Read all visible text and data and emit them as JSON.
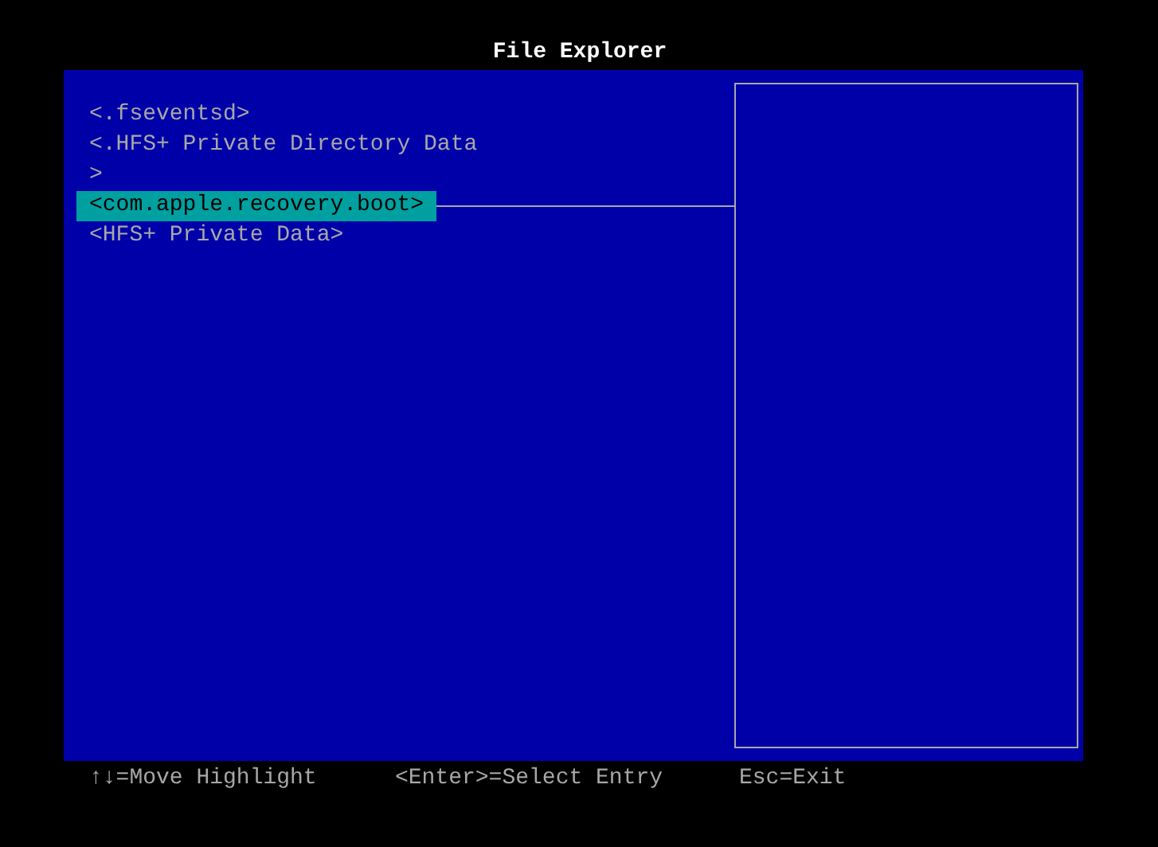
{
  "window": {
    "title": "File Explorer"
  },
  "entries": [
    {
      "label": "<.fseventsd>",
      "selected": false
    },
    {
      "label": "<.HFS+ Private Directory Data",
      "selected": false
    },
    {
      "label": ">",
      "selected": false
    },
    {
      "label": "<com.apple.recovery.boot>",
      "selected": true
    },
    {
      "label": "<HFS+ Private Data>",
      "selected": false
    }
  ],
  "status_bar": [
    "↑↓=Move Highlight",
    "<Enter>=Select Entry",
    "Esc=Exit"
  ]
}
